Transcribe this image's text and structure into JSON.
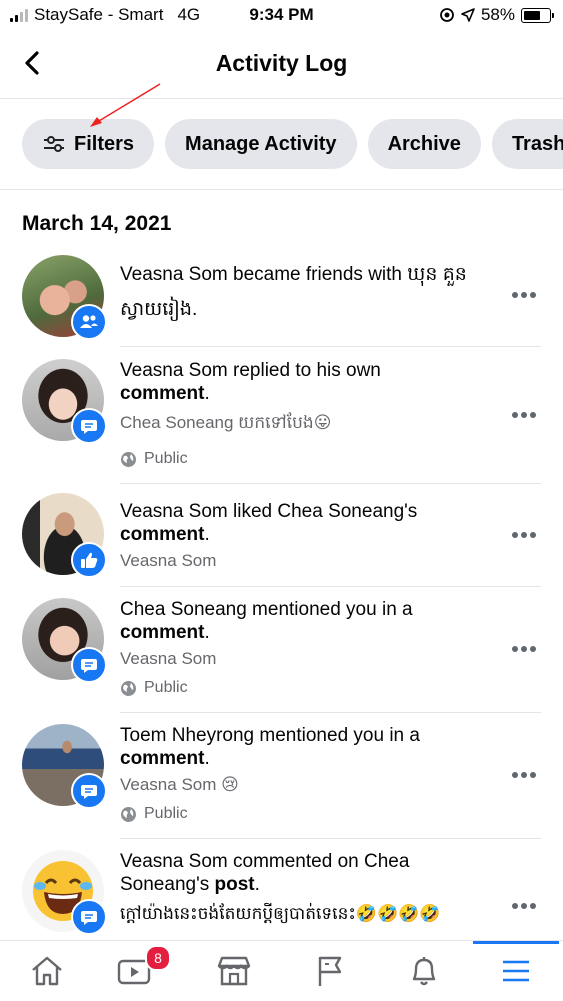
{
  "status_bar": {
    "carrier": "StaySafe - Smart",
    "network": "4G",
    "time": "9:34 PM",
    "battery": "58%"
  },
  "header": {
    "title": "Activity Log"
  },
  "filters": [
    {
      "label": "Filters"
    },
    {
      "label": "Manage Activity"
    },
    {
      "label": "Archive"
    },
    {
      "label": "Trash"
    }
  ],
  "date": "March 14, 2021",
  "items": [
    {
      "line1": "Veasna Som became friends with ឃុន គួន",
      "line2": "ស្វាយរៀង.",
      "badge": "friends-icon"
    },
    {
      "line1": "Veasna Som replied to his own",
      "bold": "comment",
      "sub": "Chea Soneang  យកទៅបែង😛",
      "privacy": "Public",
      "badge": "comment-icon"
    },
    {
      "line1": "Veasna Som liked Chea Soneang's",
      "bold": "comment",
      "sub": "Veasna Som",
      "badge": "like-icon"
    },
    {
      "line1": "Chea Soneang mentioned you in a",
      "bold": "comment",
      "sub": "Veasna Som",
      "privacy": "Public",
      "badge": "comment-icon"
    },
    {
      "line1": "Toem Nheyrong mentioned you in a",
      "bold": "comment",
      "sub": "Veasna Som 😢",
      "privacy": "Public",
      "badge": "comment-icon"
    },
    {
      "line1": "Veasna Som commented on Chea",
      "line2": "Soneang's",
      "bold": "post",
      "sub": "ក្តៅយ៉ាងនេះចង់តែយកប្តីឲ្យបាត់ទេនេះ🤣🤣🤣🤣",
      "badge": "comment-icon"
    }
  ],
  "tabbar": {
    "video_badge": "8"
  },
  "colors": {
    "accent": "#1877f2",
    "chip_bg": "#e4e6eb",
    "notification": "#e41e3f"
  }
}
